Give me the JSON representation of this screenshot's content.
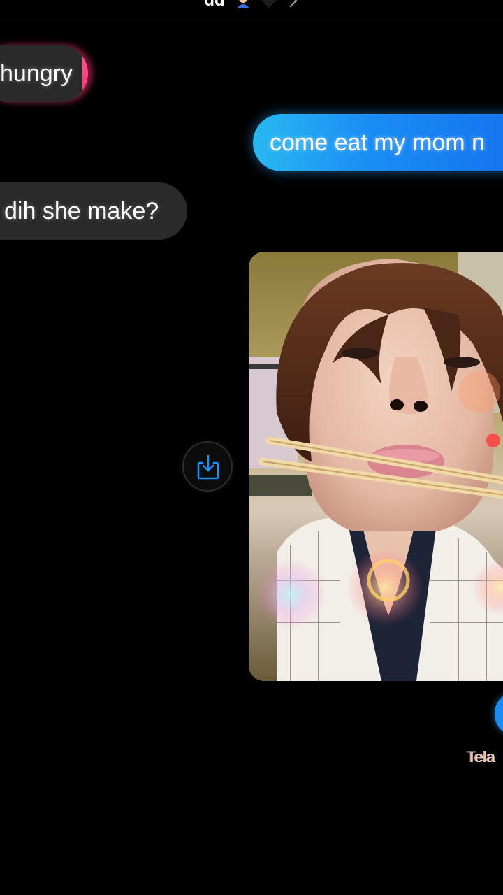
{
  "header": {
    "title": "dd",
    "icons": [
      "person-emoji-icon",
      "black-heart-icon",
      "chevron-right-icon"
    ]
  },
  "messages": [
    {
      "direction": "received",
      "text": "hungry"
    },
    {
      "direction": "sent",
      "text": "come eat my mom n"
    },
    {
      "direction": "received",
      "text": "dih she make?"
    },
    {
      "direction": "sent",
      "type": "photo"
    }
  ],
  "photo_actions": {
    "save_icon": "download-icon"
  },
  "status": {
    "text": "Tela"
  },
  "colors": {
    "background": "#000000",
    "received_bubble": "#2a2a2a",
    "sent_bubble_start": "#28b8f2",
    "sent_bubble_end": "#1473ee",
    "accent_pink": "#ff3c78",
    "save_icon": "#1e8fff"
  }
}
